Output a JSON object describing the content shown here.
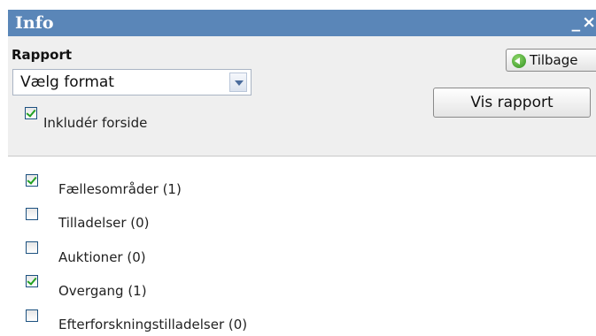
{
  "window": {
    "title": "Info",
    "minimize": "_",
    "close": "×"
  },
  "report": {
    "label": "Rapport",
    "format_select": "Vælg format",
    "include_cover": {
      "label": "Inkludér forside",
      "checked": true
    },
    "back_button": "Tilbage",
    "show_button": "Vis rapport"
  },
  "categories": [
    {
      "label": "Fællesområder (1)",
      "checked": true
    },
    {
      "label": "Tilladelser (0)",
      "checked": false
    },
    {
      "label": "Auktioner (0)",
      "checked": false
    },
    {
      "label": "Overgang (1)",
      "checked": true
    },
    {
      "label": "Efterforskningstilladelser (0)",
      "checked": false
    }
  ]
}
